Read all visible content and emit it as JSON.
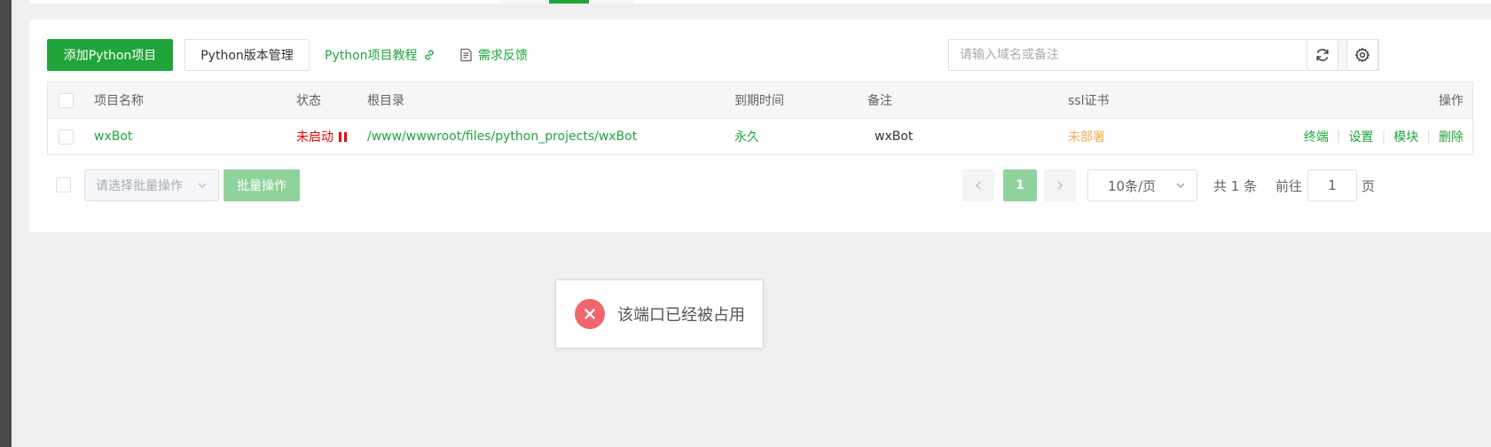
{
  "toolbar": {
    "add_project": "添加Python项目",
    "version_manage": "Python版本管理",
    "tutorial": "Python项目教程",
    "feedback": "需求反馈",
    "search_placeholder": "请输入域名或备注"
  },
  "table": {
    "headers": {
      "name": "项目名称",
      "status": "状态",
      "root": "根目录",
      "expire": "到期时间",
      "remark": "备注",
      "ssl": "ssl证书",
      "ops": "操作"
    },
    "rows": [
      {
        "name": "wxBot",
        "status": "未启动",
        "root": "/www/wwwroot/files/python_projects/wxBot",
        "expire": "永久",
        "remark": "wxBot",
        "ssl": "未部署",
        "ops": {
          "terminal": "终端",
          "settings": "设置",
          "modules": "模块",
          "delete": "删除"
        }
      }
    ]
  },
  "footer": {
    "batch_placeholder": "请选择批量操作",
    "batch_button": "批量操作",
    "current_page": "1",
    "page_size": "10条/页",
    "total": "共 1 条",
    "goto_label": "前往",
    "goto_value": "1",
    "goto_suffix": "页"
  },
  "toast": {
    "message": "该端口已经被占用"
  },
  "colors": {
    "primary": "#20a53a",
    "primary_light": "#90d29c",
    "danger": "#ee0000",
    "warning": "#f0ad4e",
    "toast_error": "#f0666a"
  }
}
